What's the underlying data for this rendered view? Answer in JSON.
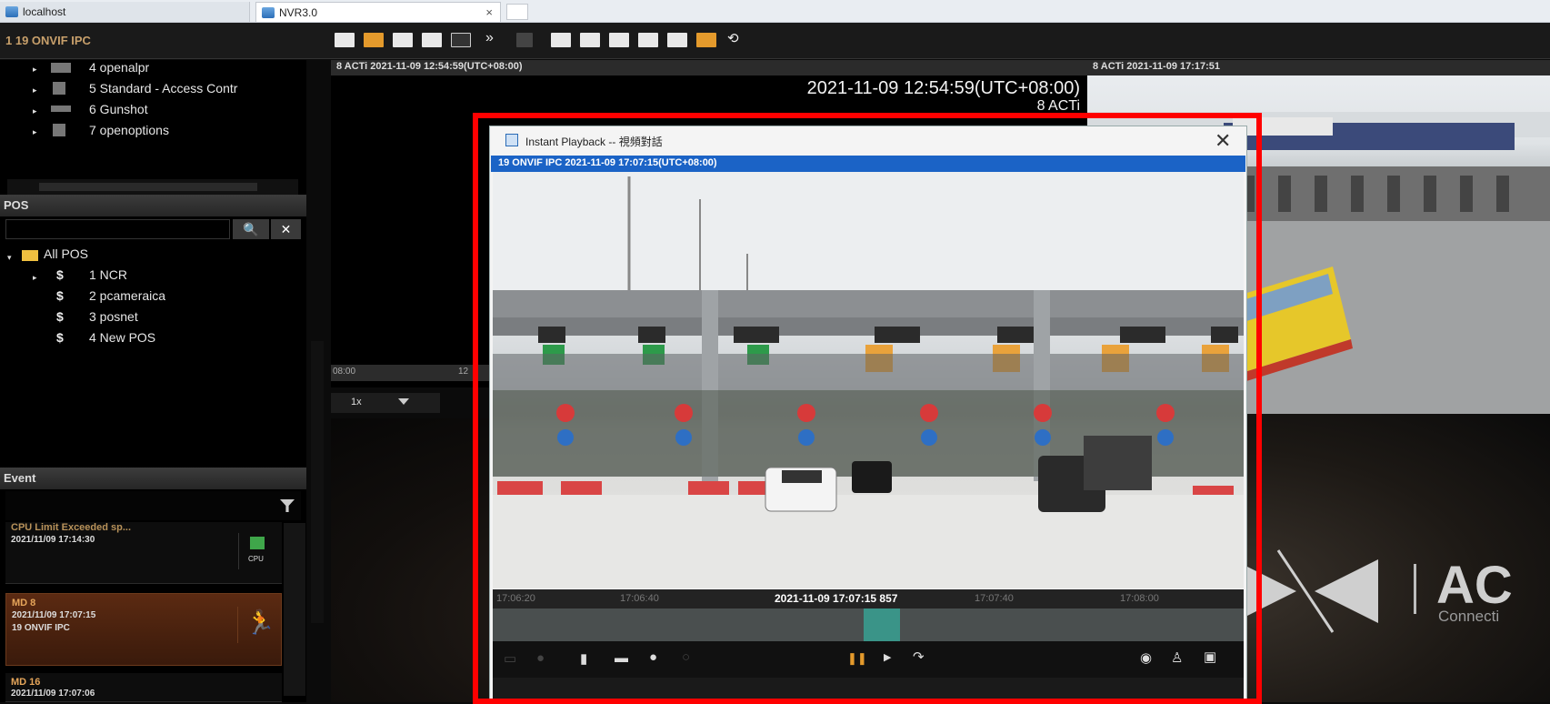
{
  "browser": {
    "tabs": [
      {
        "label": "localhost"
      },
      {
        "label": "NVR3.0",
        "close": "×"
      }
    ]
  },
  "header": {
    "channel_title": "1 19 ONVIF IPC",
    "more_label": "»"
  },
  "device_tree": {
    "items": [
      {
        "label": "4 openalpr"
      },
      {
        "label": "5 Standard - Access Contr"
      },
      {
        "label": "6 Gunshot"
      },
      {
        "label": "7 openoptions"
      }
    ]
  },
  "pos": {
    "section_title": "POS",
    "search_icon": "🔍",
    "clear_icon": "✕",
    "root_label": "All POS",
    "items": [
      {
        "symbol": "$",
        "label": "1 NCR"
      },
      {
        "symbol": "$",
        "label": "2 pcameraica"
      },
      {
        "symbol": "$",
        "label": "3 posnet"
      },
      {
        "symbol": "$",
        "label": "4 New POS"
      }
    ]
  },
  "event": {
    "section_title": "Event",
    "items": [
      {
        "title": "CPU Limit Exceeded sp...",
        "time": "2021/11/09 17:14:30",
        "source": "",
        "icon_label": "CPU"
      },
      {
        "title": "MD 8",
        "time": "2021/11/09 17:07:15",
        "source": "19 ONVIF IPC",
        "icon_label": ""
      },
      {
        "title": "MD 16",
        "time": "2021/11/09 17:07:06",
        "source": "",
        "icon_label": ""
      }
    ]
  },
  "tile_a": {
    "header": "8 ACTi  2021-11-09 12:54:59(UTC+08:00)",
    "timestamp": "2021-11-09 12:54:59(UTC+08:00)",
    "subtitle": "8 ACTi",
    "timeline_left": "08:00",
    "timeline_right": "12",
    "speed": "1x"
  },
  "tile_b": {
    "header": "8 ACTi  2021-11-09 17:17:51",
    "logo_text": "AC",
    "logo_sub": "Connecti"
  },
  "dialog": {
    "title": "Instant Playback -- 視頻對話",
    "close": "✕",
    "video_header": "19 ONVIF IPC   2021-11-09 17:07:15(UTC+08:00)",
    "timeline": {
      "t1": "17:06:20",
      "t2": "17:06:40",
      "current": "2021-11-09 17:07:15 857",
      "t4": "17:07:40",
      "t5": "17:08:00"
    },
    "pause_icon": "❚❚",
    "play_icon": "▶"
  }
}
